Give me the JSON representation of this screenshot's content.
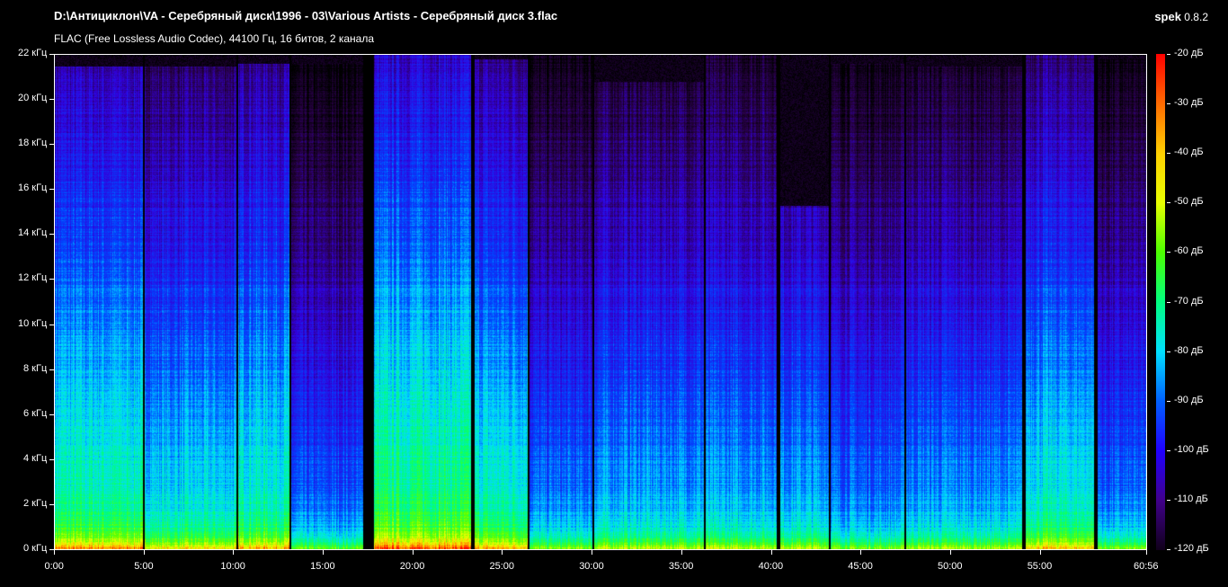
{
  "header": {
    "title": "D:\\Антициклон\\VA - Серебряный диск\\1996 - 03\\Various Artists - Серебряный диск 3.flac",
    "subtitle": "FLAC (Free Lossless Audio Codec), 44100 Гц, 16 битов, 2 канала",
    "app_name": "spek",
    "app_version": "0.8.2"
  },
  "chart_data": {
    "type": "heatmap",
    "title": "Spectrogram",
    "x_ticks": [
      "0:00",
      "5:00",
      "10:00",
      "15:00",
      "20:00",
      "25:00",
      "30:00",
      "35:00",
      "40:00",
      "45:00",
      "50:00",
      "55:00",
      "60:56"
    ],
    "x_tick_minutes": [
      0,
      5,
      10,
      15,
      20,
      25,
      30,
      35,
      40,
      45,
      50,
      55,
      60.933
    ],
    "xlim_minutes": [
      0,
      60.933
    ],
    "y_ticks": [
      "0 кГц",
      "2 кГц",
      "4 кГц",
      "6 кГц",
      "8 кГц",
      "10 кГц",
      "12 кГц",
      "14 кГц",
      "16 кГц",
      "18 кГц",
      "20 кГц",
      "22 кГц"
    ],
    "ylim_khz": [
      0,
      22
    ],
    "colorbar_ticks": [
      "-20 дБ",
      "-30 дБ",
      "-40 дБ",
      "-50 дБ",
      "-60 дБ",
      "-70 дБ",
      "-80 дБ",
      "-90 дБ",
      "-100 дБ",
      "-110 дБ",
      "-120 дБ"
    ],
    "colorbar_range_db": [
      -120,
      -20
    ],
    "tracks": [
      {
        "start": 0,
        "end": 4.9,
        "cutoff_khz": 21.5,
        "level": 0.62
      },
      {
        "start": 5.0,
        "end": 10.1,
        "cutoff_khz": 21.5,
        "level": 0.55
      },
      {
        "start": 10.2,
        "end": 13.1,
        "cutoff_khz": 21.6,
        "level": 0.6
      },
      {
        "start": 13.2,
        "end": 17.2,
        "cutoff_khz": 21.6,
        "level": 0.42
      },
      {
        "start": 17.8,
        "end": 23.2,
        "cutoff_khz": 22,
        "level": 0.66
      },
      {
        "start": 23.4,
        "end": 26.4,
        "cutoff_khz": 21.8,
        "level": 0.6
      },
      {
        "start": 26.5,
        "end": 30.0,
        "cutoff_khz": 22,
        "level": 0.45
      },
      {
        "start": 30.1,
        "end": 36.2,
        "cutoff_khz": 20.8,
        "level": 0.5
      },
      {
        "start": 36.3,
        "end": 40.3,
        "cutoff_khz": 22,
        "level": 0.5
      },
      {
        "start": 40.5,
        "end": 43.2,
        "cutoff_khz": 15.3,
        "level": 0.5
      },
      {
        "start": 43.3,
        "end": 47.4,
        "cutoff_khz": 21.6,
        "level": 0.45
      },
      {
        "start": 47.5,
        "end": 54.0,
        "cutoff_khz": 21.5,
        "level": 0.48
      },
      {
        "start": 54.2,
        "end": 58.0,
        "cutoff_khz": 22,
        "level": 0.58
      },
      {
        "start": 58.2,
        "end": 60.93,
        "cutoff_khz": 21.8,
        "level": 0.44
      }
    ]
  }
}
